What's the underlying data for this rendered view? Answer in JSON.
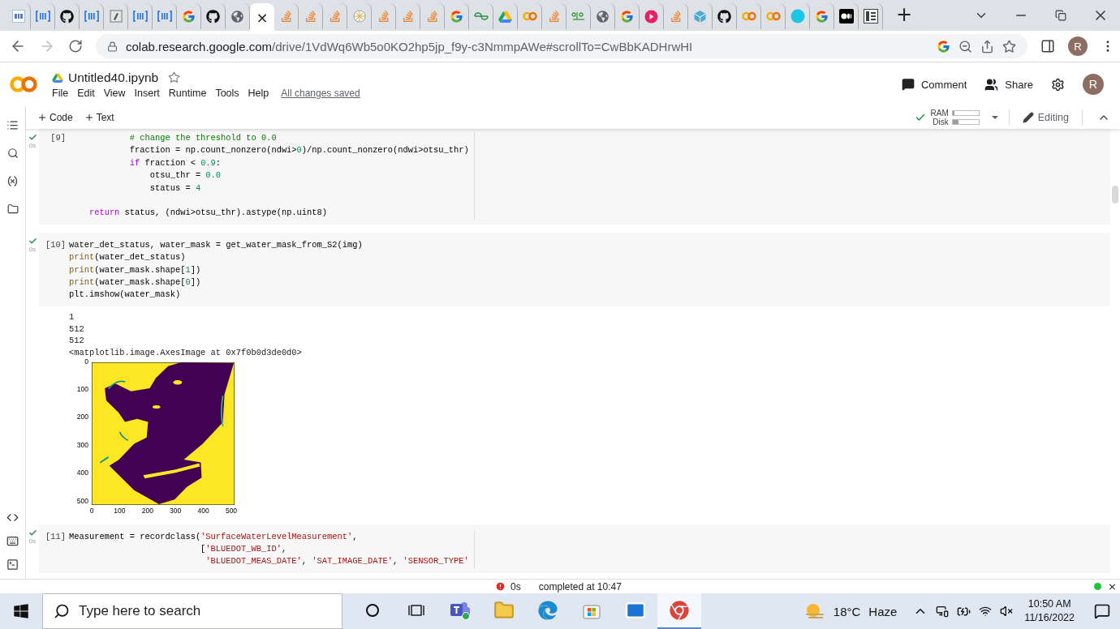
{
  "browser": {
    "tabs": [
      {
        "kind": "gvf",
        "selected": false
      },
      {
        "kind": "bracket",
        "selected": false
      },
      {
        "kind": "github",
        "selected": false
      },
      {
        "kind": "bracket",
        "selected": false
      },
      {
        "kind": "paper",
        "selected": false
      },
      {
        "kind": "bracket",
        "selected": false
      },
      {
        "kind": "bracket",
        "selected": false
      },
      {
        "kind": "google",
        "selected": false
      },
      {
        "kind": "github",
        "selected": false
      },
      {
        "kind": "globe",
        "selected": false
      },
      {
        "kind": "blank",
        "selected": true,
        "close": "×"
      },
      {
        "kind": "stack",
        "selected": false
      },
      {
        "kind": "stack",
        "selected": false
      },
      {
        "kind": "stack",
        "selected": false
      },
      {
        "kind": "wheel",
        "selected": false
      },
      {
        "kind": "stack",
        "selected": false
      },
      {
        "kind": "stack",
        "selected": false
      },
      {
        "kind": "stack",
        "selected": false
      },
      {
        "kind": "google",
        "selected": false
      },
      {
        "kind": "geeks",
        "selected": false
      },
      {
        "kind": "drive",
        "selected": false
      },
      {
        "kind": "colab",
        "selected": false
      },
      {
        "kind": "stack",
        "selected": false
      },
      {
        "kind": "olo",
        "selected": false
      },
      {
        "kind": "globe",
        "selected": false
      },
      {
        "kind": "google",
        "selected": false
      },
      {
        "kind": "video",
        "selected": false
      },
      {
        "kind": "stack",
        "selected": false
      },
      {
        "kind": "numpy",
        "selected": false
      },
      {
        "kind": "github",
        "selected": false
      },
      {
        "kind": "colab",
        "selected": false
      },
      {
        "kind": "colab",
        "selected": false
      },
      {
        "kind": "circle",
        "selected": false
      },
      {
        "kind": "google",
        "selected": false
      },
      {
        "kind": "medium",
        "selected": false
      },
      {
        "kind": "reader",
        "selected": false
      }
    ],
    "new_tab": "+",
    "address": {
      "host": "colab.research.google.com",
      "path": "/drive/1VdWq6Wb5o0KO2hp5jp_f9y-c3NmmpAWe#scrollTo=CwBbKADHrwHI",
      "starred": false
    },
    "profile": "R"
  },
  "notebook": {
    "title": "Untitled40.ipynb",
    "starred": false,
    "menu": [
      "File",
      "Edit",
      "View",
      "Insert",
      "Runtime",
      "Tools",
      "Help"
    ],
    "save_status": "All changes saved",
    "comment": "Comment",
    "share": "Share",
    "avatar": "R",
    "add_buttons": [
      "Code",
      "Text"
    ],
    "resources": {
      "connected": true,
      "ram": {
        "label": "RAM",
        "level": 0.08
      },
      "disk": {
        "label": "Disk",
        "level": 0.22
      }
    },
    "mode": "Editing"
  },
  "cells": [
    {
      "count": "[9]",
      "done": true,
      "run_time": "0s",
      "ruler": true,
      "lines": [
        {
          "kind": "code",
          "tokens": [
            {
              "kind": "cmt",
              "text": "            # change the threshold to 0.0"
            }
          ]
        },
        {
          "kind": "code",
          "tokens": [
            {
              "kind": "plain",
              "text": "            fraction = np.count_nonzero(ndwi>"
            },
            {
              "kind": "num",
              "text": "0"
            },
            {
              "kind": "plain",
              "text": ")/np.count_nonzero(ndwi>otsu_thr)"
            }
          ]
        },
        {
          "kind": "code",
          "tokens": [
            {
              "kind": "kw",
              "text": "            if"
            },
            {
              "kind": "plain",
              "text": " fraction < "
            },
            {
              "kind": "num",
              "text": "0.9"
            },
            {
              "kind": "plain",
              "text": ":"
            }
          ]
        },
        {
          "kind": "code",
          "tokens": [
            {
              "kind": "plain",
              "text": "                otsu_thr = "
            },
            {
              "kind": "num",
              "text": "0.0"
            }
          ]
        },
        {
          "kind": "code",
          "tokens": [
            {
              "kind": "plain",
              "text": "                status = "
            },
            {
              "kind": "num",
              "text": "4"
            }
          ]
        },
        {
          "kind": "blank"
        },
        {
          "kind": "code",
          "tokens": [
            {
              "kind": "kw",
              "text": "    return"
            },
            {
              "kind": "plain",
              "text": " status, (ndwi>otsu_thr).astype(np.uint8)"
            }
          ]
        }
      ]
    },
    {
      "count": "[10]",
      "done": true,
      "run_time": "0s",
      "ruler": false,
      "lines": [
        {
          "kind": "code",
          "tokens": [
            {
              "kind": "plain",
              "text": "water_det_status, water_mask = get_water_mask_from_S2(img)"
            }
          ]
        },
        {
          "kind": "code",
          "tokens": [
            {
              "kind": "fn",
              "text": "print"
            },
            {
              "kind": "plain",
              "text": "(water_det_status)"
            }
          ]
        },
        {
          "kind": "code",
          "tokens": [
            {
              "kind": "fn",
              "text": "print"
            },
            {
              "kind": "plain",
              "text": "(water_mask.shape["
            },
            {
              "kind": "num",
              "text": "1"
            },
            {
              "kind": "plain",
              "text": "])"
            }
          ]
        },
        {
          "kind": "code",
          "tokens": [
            {
              "kind": "fn",
              "text": "print"
            },
            {
              "kind": "plain",
              "text": "(water_mask.shape["
            },
            {
              "kind": "num",
              "text": "0"
            },
            {
              "kind": "plain",
              "text": "])"
            }
          ]
        },
        {
          "kind": "code",
          "tokens": [
            {
              "kind": "plain",
              "text": "plt.imshow(water_mask)"
            }
          ]
        }
      ],
      "output": {
        "lines": [
          "1",
          "512",
          "512",
          "<matplotlib.image.AxesImage at 0x7f0b0d3de0d0>"
        ],
        "plot": {
          "yticks": [
            "0",
            "100",
            "200",
            "300",
            "400",
            "500"
          ],
          "xticks": [
            "0",
            "100",
            "200",
            "300",
            "400",
            "500"
          ]
        }
      }
    },
    {
      "count": "[11]",
      "done": true,
      "run_time": "0s",
      "ruler": true,
      "lines": [
        {
          "kind": "code",
          "tokens": [
            {
              "kind": "plain",
              "text": "Measurement = recordclass("
            },
            {
              "kind": "str",
              "text": "'SurfaceWaterLevelMeasurement'"
            },
            {
              "kind": "plain",
              "text": ","
            }
          ]
        },
        {
          "kind": "code",
          "tokens": [
            {
              "kind": "plain",
              "text": "                          ["
            },
            {
              "kind": "str",
              "text": "'BLUEDOT_WB_ID'"
            },
            {
              "kind": "plain",
              "text": ","
            }
          ]
        },
        {
          "kind": "code",
          "tokens": [
            {
              "kind": "str",
              "text": "                           'BLUEDOT_MEAS_DATE'"
            },
            {
              "kind": "plain",
              "text": ", "
            },
            {
              "kind": "str",
              "text": "'SAT_IMAGE_DATE'"
            },
            {
              "kind": "plain",
              "text": ", "
            },
            {
              "kind": "str",
              "text": "'SENSOR_TYPE'"
            }
          ]
        }
      ]
    }
  ],
  "status_bar": {
    "error": true,
    "time": "0s",
    "message": "completed at 10:47",
    "connected": true,
    "close": "×"
  },
  "taskbar": {
    "search": {
      "placeholder": "Type here to search"
    },
    "apps": [
      {
        "kind": "cortana",
        "selected": false
      },
      {
        "kind": "taskview",
        "selected": false
      },
      {
        "kind": "teams",
        "selected": false
      },
      {
        "kind": "explorer",
        "selected": false
      },
      {
        "kind": "edge",
        "selected": false
      },
      {
        "kind": "store",
        "selected": false
      },
      {
        "kind": "mail",
        "selected": false
      },
      {
        "kind": "chrome",
        "selected": true
      }
    ],
    "weather": {
      "temp": "18°C",
      "condition": "Haze"
    },
    "clock": {
      "time": "10:50 AM",
      "date": "11/16/2022"
    }
  }
}
